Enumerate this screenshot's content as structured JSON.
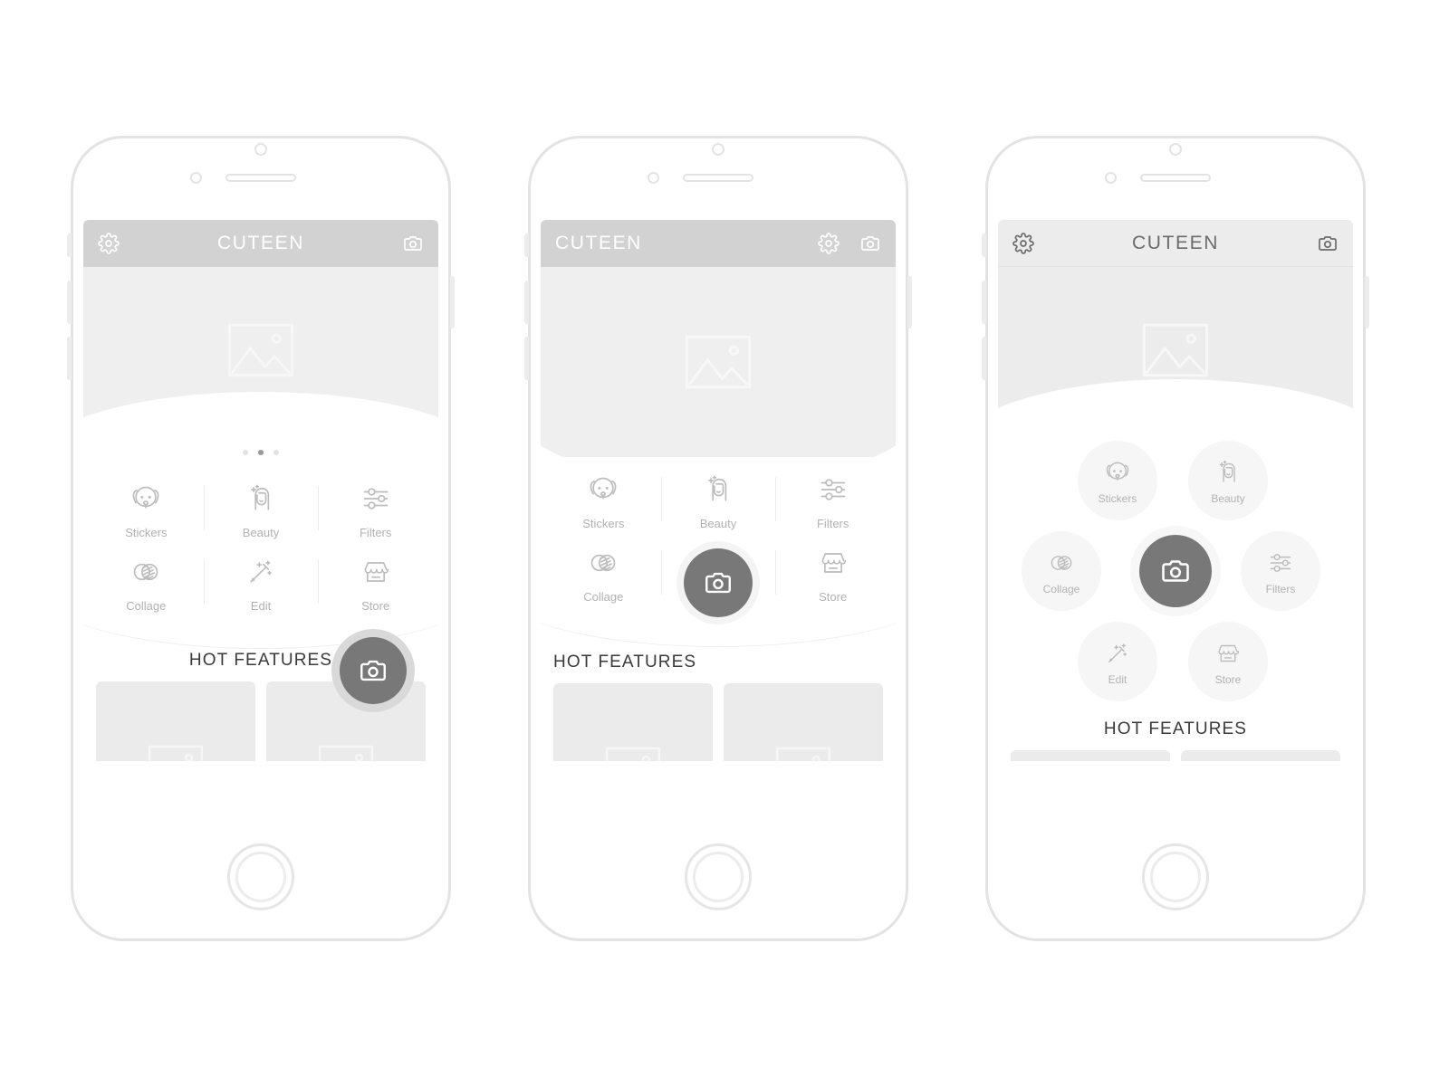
{
  "app": {
    "name": "CUTEEN",
    "hot_features_label": "HOT FEATURES"
  },
  "icons": {
    "gear": "gear-icon",
    "camera": "camera-icon",
    "image_placeholder": "image-placeholder-icon"
  },
  "features": [
    {
      "id": "stickers",
      "label": "Stickers",
      "icon": "dog-face-icon"
    },
    {
      "id": "beauty",
      "label": "Beauty",
      "icon": "beauty-portrait-icon"
    },
    {
      "id": "filters",
      "label": "Filters",
      "icon": "sliders-icon"
    },
    {
      "id": "collage",
      "label": "Collage",
      "icon": "overlapping-circles-icon"
    },
    {
      "id": "edit",
      "label": "Edit",
      "icon": "magic-wand-icon"
    },
    {
      "id": "store",
      "label": "Store",
      "icon": "storefront-icon"
    }
  ],
  "colors": {
    "header_dark": "#d2d2d2",
    "header_light": "#ececec",
    "hero": "#efefef",
    "fab": "#787878",
    "icon_gray": "#bcbcbc",
    "label_gray": "#b2b2b2",
    "title_dark": "#3a3a3a",
    "card": "#ebebeb",
    "frame": "#e3e3e3"
  },
  "screens": [
    {
      "id": "variant-a",
      "title_align": "center",
      "header_theme": "dark",
      "hero_style": "curve",
      "carousel": {
        "total": 3,
        "active_index": 1
      },
      "feature_layout": "grid",
      "hot_title_align": "center",
      "fab_position": "bottom-right-overlap",
      "cards": 2
    },
    {
      "id": "variant-b",
      "title_align": "left",
      "header_theme": "dark",
      "hero_style": "lens",
      "carousel": null,
      "feature_layout": "grid",
      "hot_title_align": "left",
      "fab_position": "center-divider",
      "cards": 2
    },
    {
      "id": "variant-c",
      "title_align": "center",
      "header_theme": "light",
      "hero_style": "curve",
      "carousel": null,
      "feature_layout": "honeycomb",
      "hot_title_align": "center",
      "fab_position": "honeycomb-center",
      "cards": 2
    }
  ]
}
